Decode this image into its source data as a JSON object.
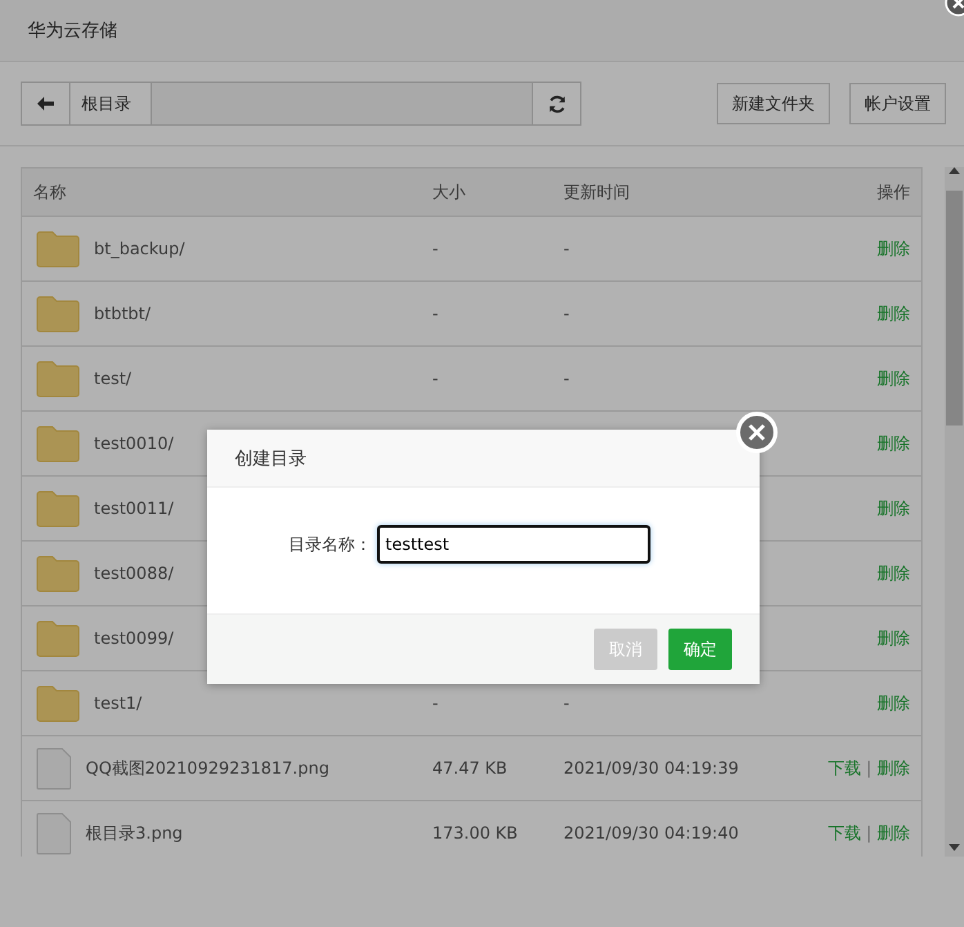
{
  "window": {
    "title": "华为云存储"
  },
  "toolbar": {
    "path": [
      "根目录"
    ],
    "buttons": [
      "新建文件夹",
      "帐户设置"
    ]
  },
  "table": {
    "action_separator": "|",
    "columns": [
      "名称",
      "大小",
      "更新时间",
      "操作"
    ],
    "rows": [
      {
        "kind": "folder",
        "name": "bt_backup/",
        "size": "-",
        "time": "-",
        "actions": [
          "删除"
        ]
      },
      {
        "kind": "folder",
        "name": "btbtbt/",
        "size": "-",
        "time": "-",
        "actions": [
          "删除"
        ]
      },
      {
        "kind": "folder",
        "name": "test/",
        "size": "-",
        "time": "-",
        "actions": [
          "删除"
        ]
      },
      {
        "kind": "folder",
        "name": "test0010/",
        "actions": [
          "删除"
        ]
      },
      {
        "kind": "folder",
        "name": "test0011/",
        "actions": [
          "删除"
        ]
      },
      {
        "kind": "folder",
        "name": "test0088/",
        "actions": [
          "删除"
        ]
      },
      {
        "kind": "folder",
        "name": "test0099/",
        "actions": [
          "删除"
        ]
      },
      {
        "kind": "folder",
        "name": "test1/",
        "size": "-",
        "time": "-",
        "actions": [
          "删除"
        ]
      },
      {
        "kind": "file",
        "name": "QQ截图20210929231817.png",
        "size": "47.47 KB",
        "time": "2021/09/30 04:19:39",
        "actions": [
          "下载",
          "删除"
        ]
      },
      {
        "kind": "file",
        "name": "根目录3.png",
        "size": "173.00 KB",
        "time": "2021/09/30 04:19:40",
        "actions": [
          "下载",
          "删除"
        ]
      }
    ]
  },
  "dialog": {
    "title": "创建目录",
    "label": "目录名称：",
    "value": "testtest",
    "buttons": [
      {
        "label": "取消",
        "kind": "secondary"
      },
      {
        "label": "确定",
        "kind": "primary"
      }
    ]
  }
}
